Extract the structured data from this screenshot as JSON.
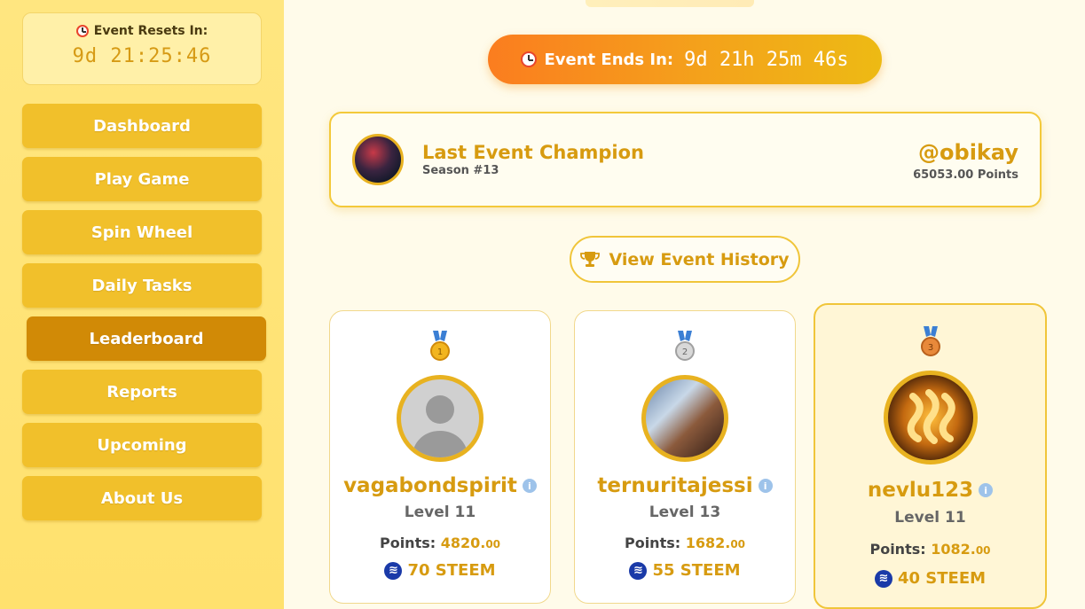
{
  "sidebar": {
    "reset": {
      "title": "Event Resets In:",
      "time": "9d 21:25:46"
    },
    "items": [
      {
        "label": "Dashboard"
      },
      {
        "label": "Play Game"
      },
      {
        "label": "Spin Wheel"
      },
      {
        "label": "Daily Tasks"
      },
      {
        "label": "Leaderboard",
        "active": true
      },
      {
        "label": "Reports"
      },
      {
        "label": "Upcoming"
      },
      {
        "label": "About Us"
      }
    ]
  },
  "event": {
    "ends_label": "Event Ends In:",
    "ends_timer": "9d 21h 25m 46s"
  },
  "champion": {
    "title": "Last Event Champion",
    "season": "Season #13",
    "username": "@obikay",
    "points": "65053.00 Points"
  },
  "history_button": "View Event History",
  "leaderboard": [
    {
      "rank": 1,
      "medal": "gold-medal-icon",
      "username": "vagabondspirit",
      "level": "Level 11",
      "points_label": "Points:",
      "points_value": "4820.",
      "points_decimal": "00",
      "reward": "70 STEEM"
    },
    {
      "rank": 2,
      "medal": "silver-medal-icon",
      "username": "ternuritajessi",
      "level": "Level 13",
      "points_label": "Points:",
      "points_value": "1682.",
      "points_decimal": "00",
      "reward": "55 STEEM"
    },
    {
      "rank": 3,
      "medal": "bronze-medal-icon",
      "username": "nevlu123",
      "level": "Level 11",
      "points_label": "Points:",
      "points_value": "1082.",
      "points_decimal": "00",
      "reward": "40 STEEM"
    }
  ],
  "colors": {
    "accent": "#d79b10",
    "sidebar_button": "#f1c02b",
    "sidebar_active": "#d18a06",
    "steem_blue": "#1a3aa8"
  }
}
